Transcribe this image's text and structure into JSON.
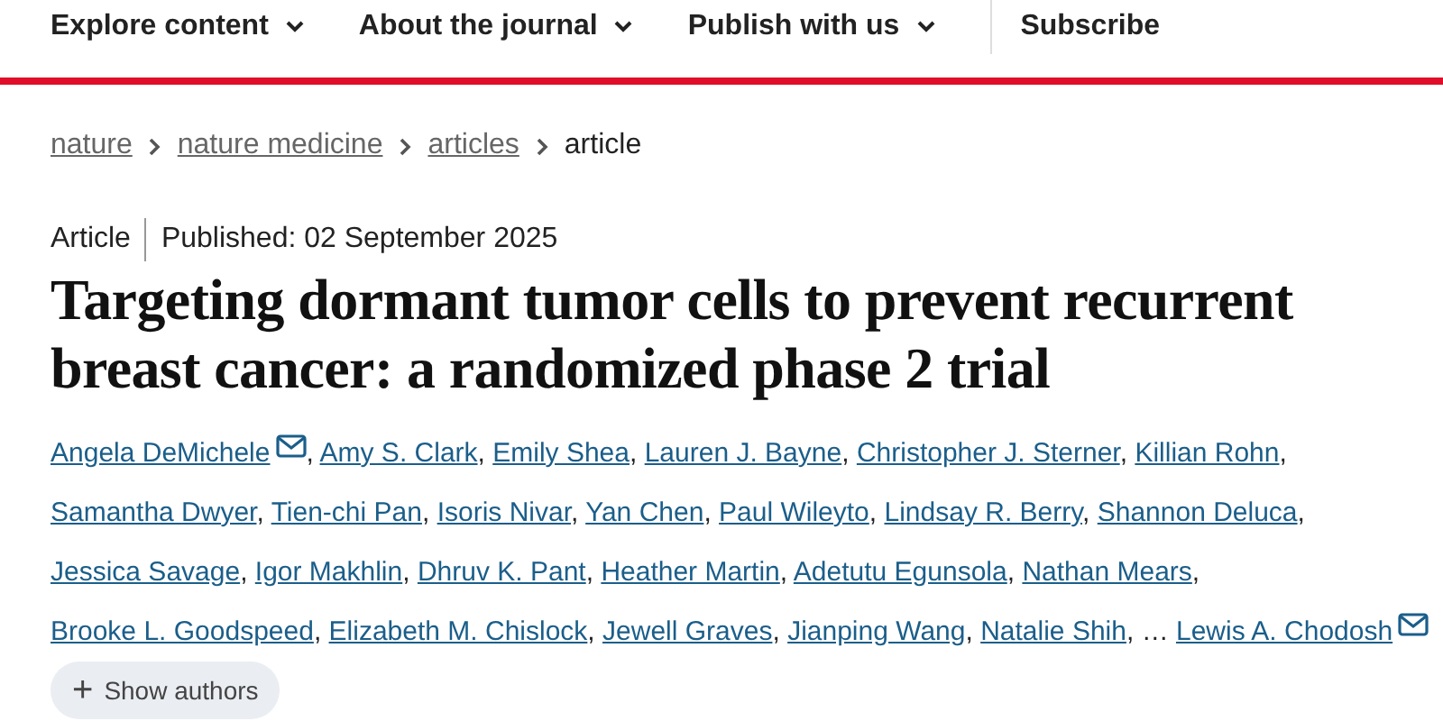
{
  "nav": {
    "items": [
      {
        "label": "Explore content",
        "dropdown": true
      },
      {
        "label": "About the journal",
        "dropdown": true
      },
      {
        "label": "Publish with us",
        "dropdown": true
      },
      {
        "label": "Subscribe",
        "dropdown": false
      }
    ]
  },
  "breadcrumb": [
    {
      "label": "nature",
      "current": false
    },
    {
      "label": "nature medicine",
      "current": false
    },
    {
      "label": "articles",
      "current": false
    },
    {
      "label": "article",
      "current": true
    }
  ],
  "article": {
    "type": "Article",
    "published": "Published: 02 September 2025",
    "title": "Targeting dormant tumor cells to prevent recurrent breast cancer: a randomized phase 2 trial",
    "authors": [
      {
        "name": "Angela DeMichele",
        "email": true,
        "sep": ","
      },
      {
        "name": "Amy S. Clark",
        "email": false,
        "sep": ","
      },
      {
        "name": "Emily Shea",
        "email": false,
        "sep": ","
      },
      {
        "name": "Lauren J. Bayne",
        "email": false,
        "sep": ","
      },
      {
        "name": "Christopher J. Sterner",
        "email": false,
        "sep": ","
      },
      {
        "name": "Killian Rohn",
        "email": false,
        "sep": ","
      },
      {
        "name": "Samantha Dwyer",
        "email": false,
        "sep": ","
      },
      {
        "name": "Tien-chi Pan",
        "email": false,
        "sep": ","
      },
      {
        "name": "Isoris Nivar",
        "email": false,
        "sep": ","
      },
      {
        "name": "Yan Chen",
        "email": false,
        "sep": ","
      },
      {
        "name": "Paul Wileyto",
        "email": false,
        "sep": ","
      },
      {
        "name": "Lindsay R. Berry",
        "email": false,
        "sep": ","
      },
      {
        "name": "Shannon Deluca",
        "email": false,
        "sep": ","
      },
      {
        "name": "Jessica Savage",
        "email": false,
        "sep": ","
      },
      {
        "name": "Igor Makhlin",
        "email": false,
        "sep": ","
      },
      {
        "name": "Dhruv K. Pant",
        "email": false,
        "sep": ","
      },
      {
        "name": "Heather Martin",
        "email": false,
        "sep": ","
      },
      {
        "name": "Adetutu Egunsola",
        "email": false,
        "sep": ","
      },
      {
        "name": "Nathan Mears",
        "email": false,
        "sep": ","
      },
      {
        "name": "Brooke L. Goodspeed",
        "email": false,
        "sep": ","
      },
      {
        "name": "Elizabeth M. Chislock",
        "email": false,
        "sep": ","
      },
      {
        "name": "Jewell Graves",
        "email": false,
        "sep": ","
      },
      {
        "name": "Jianping Wang",
        "email": false,
        "sep": ","
      },
      {
        "name": "Natalie Shih",
        "email": false,
        "sep": ","
      },
      {
        "name": "…",
        "kind": "ellipsis",
        "email": false
      },
      {
        "name": "Lewis A. Chodosh",
        "email": true
      }
    ],
    "show_authors": {
      "icon": "+",
      "label": "Show authors"
    }
  }
}
